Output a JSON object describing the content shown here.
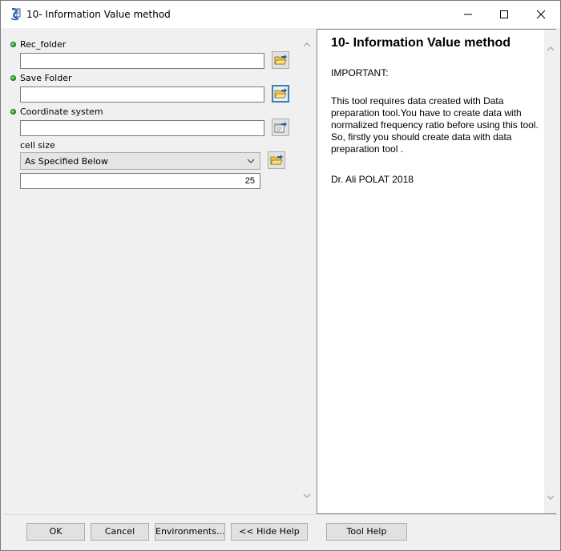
{
  "window": {
    "title": "10- Information Value method"
  },
  "icons": {
    "app": "python-script-icon",
    "folder": "folder-open-icon",
    "spatial_ref": "spatial-reference-icon",
    "chevron_up": "chevron-up-icon",
    "chevron_down": "chevron-down-icon"
  },
  "form": {
    "rec_folder": {
      "label": "Rec_folder",
      "value": ""
    },
    "save_folder": {
      "label": "Save Folder",
      "value": ""
    },
    "coordinate_system": {
      "label": "Coordinate system",
      "value": ""
    },
    "cell_size": {
      "label": "cell size",
      "selected": "As Specified Below",
      "value": "25"
    }
  },
  "help": {
    "title": "10- Information Value method",
    "important": "IMPORTANT:",
    "body": "This tool requires data created with Data preparation tool.You have to create data with normalized frequency ratio before using this tool. So, firstly you should create data with data preparation tool .",
    "author": "Dr. Ali POLAT 2018"
  },
  "buttons": {
    "ok": "OK",
    "cancel": "Cancel",
    "environments": "Environments...",
    "hide_help": "<< Hide Help",
    "tool_help": "Tool Help"
  },
  "colors": {
    "required_dot": "#1c9c1c",
    "focus_border": "#3c7fb1",
    "panel_bg": "#f0f0f0"
  }
}
